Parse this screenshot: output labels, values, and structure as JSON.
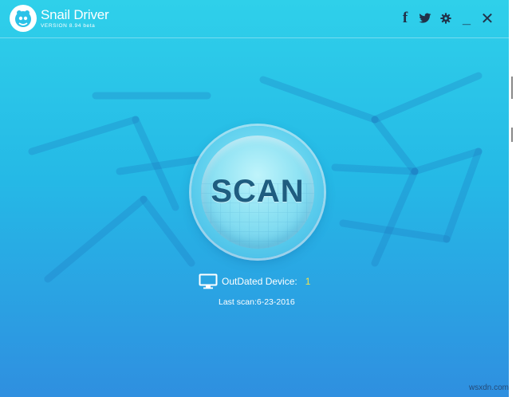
{
  "window": {
    "app_name": "Snail Driver",
    "version": "VERSION 8.94 beta",
    "buttons": {
      "facebook": "f",
      "twitter_icon": "twitter-icon",
      "settings_icon": "gear-icon",
      "minimize": "_",
      "close": "✕"
    }
  },
  "scan": {
    "label": "SCAN"
  },
  "status": {
    "outdated_label": "OutDated Device:",
    "outdated_count": "1",
    "last_scan": "Last scan:6-23-2016"
  },
  "watermark": "wsxdn.com",
  "colors": {
    "background_top": "#2fd0ea",
    "background_bottom": "#2f8fe0",
    "scan_text": "#1f5d80",
    "count_highlight": "#f6e44a",
    "icon_dark": "#21324a"
  }
}
